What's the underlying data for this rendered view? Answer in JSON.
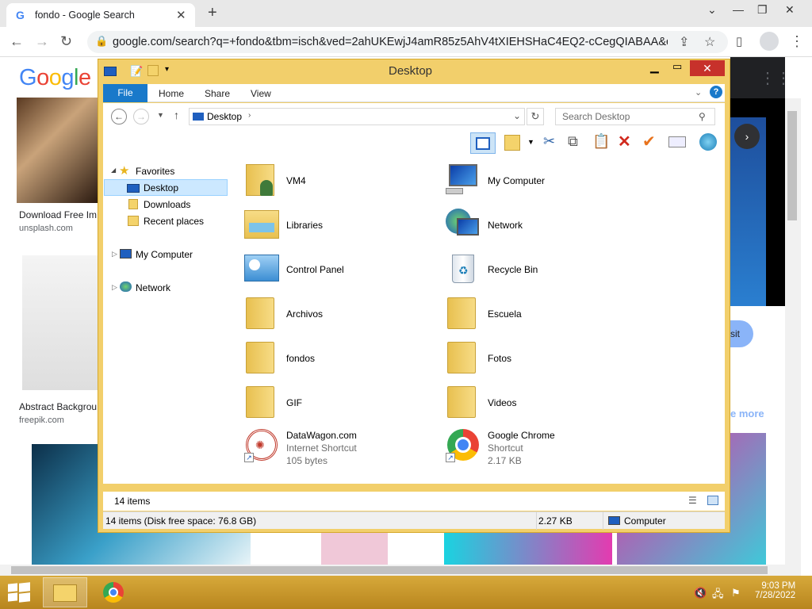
{
  "chrome": {
    "tab_title": "fondo - Google Search",
    "url": "google.com/search?q=+fondo&tbm=isch&ved=2ahUKEwjJ4amR85z5AhV4tXIEHSHaC4EQ2-cCegQIABAA&oq=..."
  },
  "google": {
    "logo": "Google",
    "result1_title": "Download Free Im",
    "result1_source": "unsplash.com",
    "result2_title": "Abstract Backgrou",
    "result2_source": "freepik.com",
    "see_more": "e more",
    "visit_fragment": "sit"
  },
  "explorer": {
    "title": "Desktop",
    "tabs": {
      "file": "File",
      "home": "Home",
      "share": "Share",
      "view": "View"
    },
    "address": "Desktop",
    "search_placeholder": "Search Desktop",
    "nav": {
      "favorites": "Favorites",
      "desktop": "Desktop",
      "downloads": "Downloads",
      "recent": "Recent places",
      "computer": "My Computer",
      "network": "Network"
    },
    "items": [
      {
        "name": "VM4",
        "sub1": "",
        "sub2": "",
        "icon": "user-folder"
      },
      {
        "name": "My Computer",
        "sub1": "",
        "sub2": "",
        "icon": "computer"
      },
      {
        "name": "Libraries",
        "sub1": "",
        "sub2": "",
        "icon": "libraries"
      },
      {
        "name": "Network",
        "sub1": "",
        "sub2": "",
        "icon": "network"
      },
      {
        "name": "Control Panel",
        "sub1": "",
        "sub2": "",
        "icon": "control-panel"
      },
      {
        "name": "Recycle Bin",
        "sub1": "",
        "sub2": "",
        "icon": "recycle-bin"
      },
      {
        "name": "Archivos",
        "sub1": "",
        "sub2": "",
        "icon": "folder"
      },
      {
        "name": "Escuela",
        "sub1": "",
        "sub2": "",
        "icon": "folder"
      },
      {
        "name": "fondos",
        "sub1": "",
        "sub2": "",
        "icon": "folder"
      },
      {
        "name": "Fotos",
        "sub1": "",
        "sub2": "",
        "icon": "folder"
      },
      {
        "name": "GIF",
        "sub1": "",
        "sub2": "",
        "icon": "folder"
      },
      {
        "name": "Videos",
        "sub1": "",
        "sub2": "",
        "icon": "folder"
      },
      {
        "name": "DataWagon.com",
        "sub1": "Internet Shortcut",
        "sub2": "105 bytes",
        "icon": "web-shortcut"
      },
      {
        "name": "Google Chrome",
        "sub1": "Shortcut",
        "sub2": "2.17 KB",
        "icon": "chrome"
      }
    ],
    "item_count": "14 items",
    "status_left": "14 items (Disk free space: 76.8 GB)",
    "status_size": "2.27 KB",
    "status_location": "Computer"
  },
  "taskbar": {
    "time": "9:03 PM",
    "date": "7/28/2022"
  }
}
